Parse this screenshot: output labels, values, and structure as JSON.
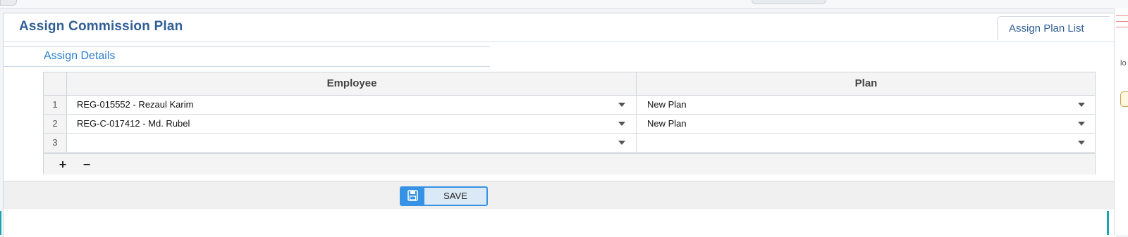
{
  "page": {
    "title": "Assign Commission Plan",
    "assign_plan_list_label": "Assign Plan List",
    "section_title": "Assign Details"
  },
  "grid": {
    "columns": [
      "Employee",
      "Plan"
    ],
    "rows": [
      {
        "num": "1",
        "employee": "REG-015552 - Rezaul Karim",
        "plan": "New Plan"
      },
      {
        "num": "2",
        "employee": "REG-C-017412 - Md. Rubel",
        "plan": "New Plan"
      },
      {
        "num": "3",
        "employee": "",
        "plan": ""
      }
    ],
    "add_label": "+",
    "remove_label": "−"
  },
  "actions": {
    "save_label": "SAVE"
  },
  "edge": {
    "fragment": "lo"
  },
  "colors": {
    "title_blue": "#2f5f94",
    "section_blue": "#2a7fd0",
    "save_accent": "#3592e4"
  },
  "icons": {
    "save": "floppy-disk-icon",
    "dropdown": "chevron-down-icon"
  }
}
